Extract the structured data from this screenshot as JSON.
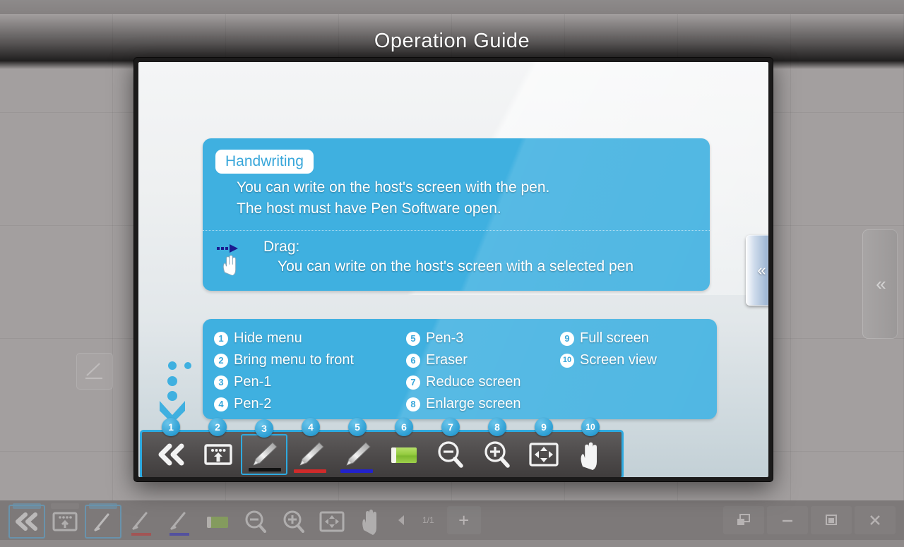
{
  "window": {
    "guide_title": "Operation Guide"
  },
  "dialog": {
    "collapse_tab_icon": "double-chevron-left-icon",
    "handwriting": {
      "pill_label": "Handwriting",
      "lines": [
        "You can write on the host's screen with the pen.",
        "The host must have Pen Software open."
      ],
      "drag_icon": "drag-hand-arrow-icon",
      "drag_title": "Drag:",
      "drag_description": "You can write on the host's screen with a selected pen"
    },
    "legend": {
      "columns": [
        [
          {
            "num": "1",
            "label": "Hide menu"
          },
          {
            "num": "2",
            "label": "Bring menu to front"
          },
          {
            "num": "3",
            "label": "Pen-1"
          },
          {
            "num": "4",
            "label": "Pen-2"
          }
        ],
        [
          {
            "num": "5",
            "label": "Pen-3"
          },
          {
            "num": "6",
            "label": "Eraser"
          },
          {
            "num": "7",
            "label": "Reduce screen"
          },
          {
            "num": "8",
            "label": "Enlarge screen"
          }
        ],
        [
          {
            "num": "9",
            "label": "Full screen"
          },
          {
            "num": "10",
            "label": "Screen view"
          }
        ]
      ]
    },
    "toolbar": {
      "selected_index": 2,
      "items": [
        {
          "num": "1",
          "icon": "double-chevron-left-icon",
          "name": "hide-menu"
        },
        {
          "num": "2",
          "icon": "bring-to-front-icon",
          "name": "bring-menu-to-front"
        },
        {
          "num": "3",
          "icon": "pen-icon",
          "name": "pen-1",
          "color": "#111111"
        },
        {
          "num": "4",
          "icon": "pen-icon",
          "name": "pen-2",
          "color": "#d02a2a"
        },
        {
          "num": "5",
          "icon": "pen-icon",
          "name": "pen-3",
          "color": "#2222cc"
        },
        {
          "num": "6",
          "icon": "eraser-icon",
          "name": "eraser",
          "color": "#8ec63f"
        },
        {
          "num": "7",
          "icon": "zoom-out-icon",
          "name": "reduce-screen"
        },
        {
          "num": "8",
          "icon": "zoom-in-icon",
          "name": "enlarge-screen"
        },
        {
          "num": "9",
          "icon": "full-screen-icon",
          "name": "full-screen"
        },
        {
          "num": "10",
          "icon": "hand-icon",
          "name": "screen-view"
        }
      ]
    }
  },
  "app_bar": {
    "page_label": "1/1",
    "add_label": "+",
    "tools": [
      {
        "icon": "double-chevron-left-icon",
        "name": "hide-menu"
      },
      {
        "icon": "bring-to-front-icon",
        "name": "bring-menu-to-front"
      },
      {
        "icon": "pen-icon",
        "name": "pen-1",
        "color": "#111111"
      },
      {
        "icon": "pen-icon",
        "name": "pen-2",
        "color": "#d02a2a"
      },
      {
        "icon": "pen-icon",
        "name": "pen-3",
        "color": "#2222cc"
      },
      {
        "icon": "eraser-icon",
        "name": "eraser",
        "color": "#8ec63f"
      },
      {
        "icon": "zoom-out-icon",
        "name": "reduce-screen"
      },
      {
        "icon": "zoom-in-icon",
        "name": "enlarge-screen"
      },
      {
        "icon": "full-screen-icon",
        "name": "full-screen"
      },
      {
        "icon": "hand-icon",
        "name": "screen-view"
      }
    ],
    "window_controls": [
      {
        "icon": "restore-windows-icon",
        "name": "cascade-windows-button"
      },
      {
        "icon": "minimize-icon",
        "name": "minimize-button"
      },
      {
        "icon": "maximize-icon",
        "name": "maximize-button"
      },
      {
        "icon": "close-icon",
        "name": "close-button"
      }
    ]
  },
  "background": {
    "collapse_tab_icon": "double-chevron-left-icon"
  },
  "colors": {
    "accent_blue": "#3fb0e0",
    "panel_blue": "#3fb0e0",
    "badge_blue": "#2d9fd4",
    "toolbar_gray": "#4d4a4a",
    "desktop_gray": "#a39f9f",
    "pen1": "#111111",
    "pen2": "#d02a2a",
    "pen3": "#2222cc",
    "eraser_green": "#8ec63f"
  }
}
